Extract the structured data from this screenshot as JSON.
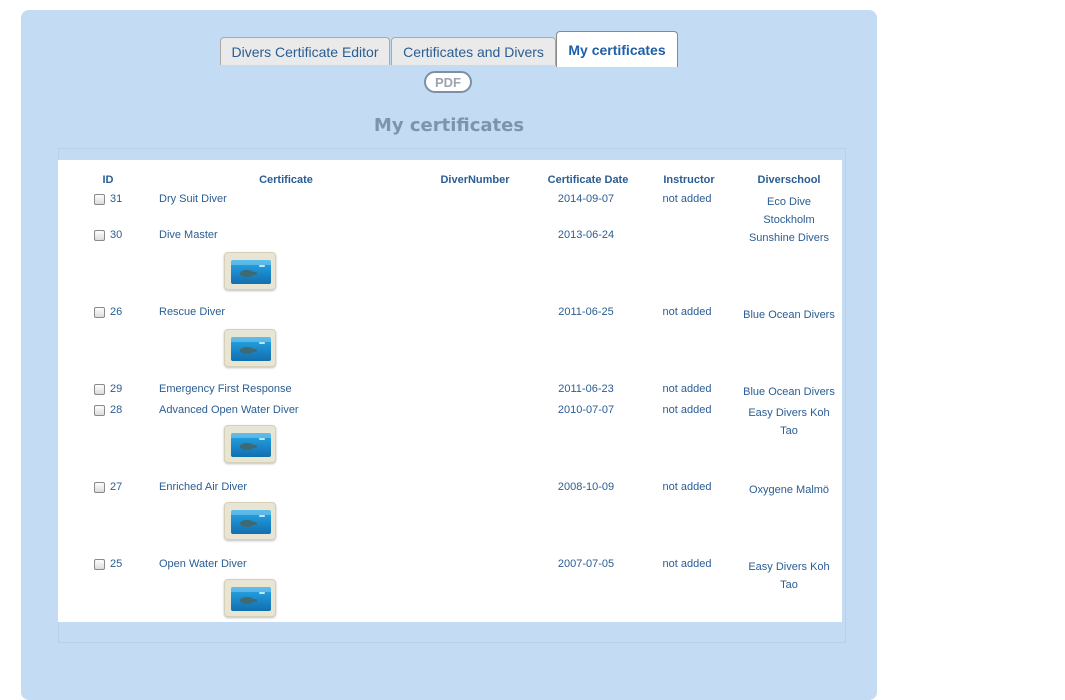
{
  "tabs": [
    {
      "label": "Divers Certificate Editor",
      "active": false
    },
    {
      "label": "Certificates and Divers",
      "active": false
    },
    {
      "label": "My certificates",
      "active": true
    }
  ],
  "pdf_button": "PDF",
  "heading": "My certificates",
  "table": {
    "headers": {
      "id": "ID",
      "certificate": "Certificate",
      "diver_number": "DiverNumber",
      "certificate_date": "Certificate Date",
      "instructor": "Instructor",
      "diverschool": "Diverschool"
    },
    "rows": [
      {
        "id": "31",
        "certificate": "Dry Suit Diver",
        "date": "2014-09-07",
        "instructor": "not added",
        "school_1": "Eco Dive",
        "school_2": "Stockholm",
        "has_card": false
      },
      {
        "id": "30",
        "certificate": "Dive Master",
        "date": "2013-06-24",
        "instructor": "",
        "school_1": "Sunshine Divers",
        "school_2": "",
        "has_card": true
      },
      {
        "id": "26",
        "certificate": "Rescue Diver",
        "date": "2011-06-25",
        "instructor": "not added",
        "school_1": "Blue Ocean Divers",
        "school_2": "",
        "has_card": true
      },
      {
        "id": "29",
        "certificate": "Emergency First Response",
        "date": "2011-06-23",
        "instructor": "not added",
        "school_1": "Blue Ocean Divers",
        "school_2": "",
        "has_card": false
      },
      {
        "id": "28",
        "certificate": "Advanced Open Water Diver",
        "date": "2010-07-07",
        "instructor": "not added",
        "school_1": "Easy Divers Koh",
        "school_2": "Tao",
        "has_card": true
      },
      {
        "id": "27",
        "certificate": "Enriched Air Diver",
        "date": "2008-10-09",
        "instructor": "not added",
        "school_1": "Oxygene Malmö",
        "school_2": "",
        "has_card": true
      },
      {
        "id": "25",
        "certificate": "Open Water Diver",
        "date": "2007-07-05",
        "instructor": "not added",
        "school_1": "Easy Divers Koh",
        "school_2": "Tao",
        "has_card": true
      }
    ]
  },
  "colors": {
    "panel_bg": "#c3dcf4",
    "link_text": "#2a5d93",
    "heading_text": "#7c94ae"
  },
  "icons": {
    "card_thumbnail": "certificate-card-icon",
    "checkbox": "row-select-checkbox"
  }
}
